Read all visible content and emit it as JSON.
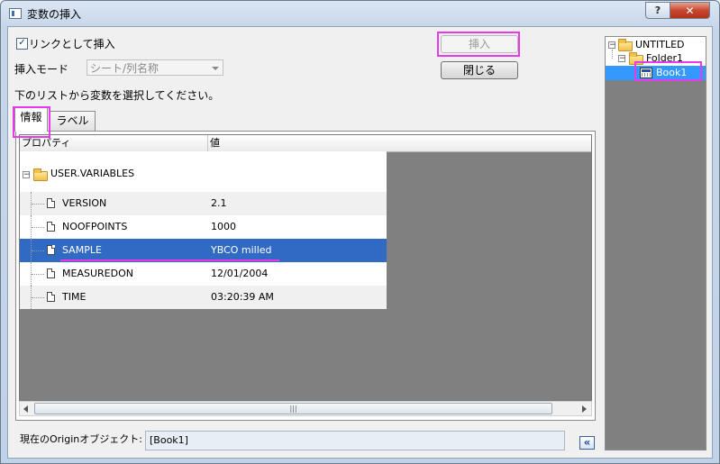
{
  "window": {
    "title": "変数の挿入",
    "help_label": "?",
    "close_label": "✕"
  },
  "options": {
    "link_checkbox_label": "リンクとして挿入",
    "link_checked": "✓",
    "mode_label": "挿入モード",
    "mode_value": "シート/列名称",
    "instruction": "下のリストから変数を選択してください。"
  },
  "buttons": {
    "insert": "挿入",
    "close": "閉じる"
  },
  "tabs": [
    {
      "label": "情報"
    },
    {
      "label": "ラベル"
    }
  ],
  "grid": {
    "columns": [
      "プロパティ",
      "値"
    ],
    "root": {
      "label": "USER.VARIABLES",
      "expander": "−"
    },
    "rows": [
      {
        "property": "VERSION",
        "value": "2.1"
      },
      {
        "property": "NOOFPOINTS",
        "value": "1000"
      },
      {
        "property": "SAMPLE",
        "value": "YBCO milled"
      },
      {
        "property": "MEASUREDON",
        "value": "12/01/2004"
      },
      {
        "property": "TIME",
        "value": "03:20:39 AM"
      }
    ],
    "selected_index": 2,
    "scroll_grip": "|||"
  },
  "tree": {
    "root": "UNTITLED",
    "folder": "Folder1",
    "book": "Book1",
    "expander": "−"
  },
  "footer": {
    "object_label": "現在のOriginオブジェクト:",
    "object_value": "[Book1]",
    "collapse_label": "«"
  },
  "colors": {
    "selection": "#316ac5",
    "highlight": "#e83ae8"
  }
}
